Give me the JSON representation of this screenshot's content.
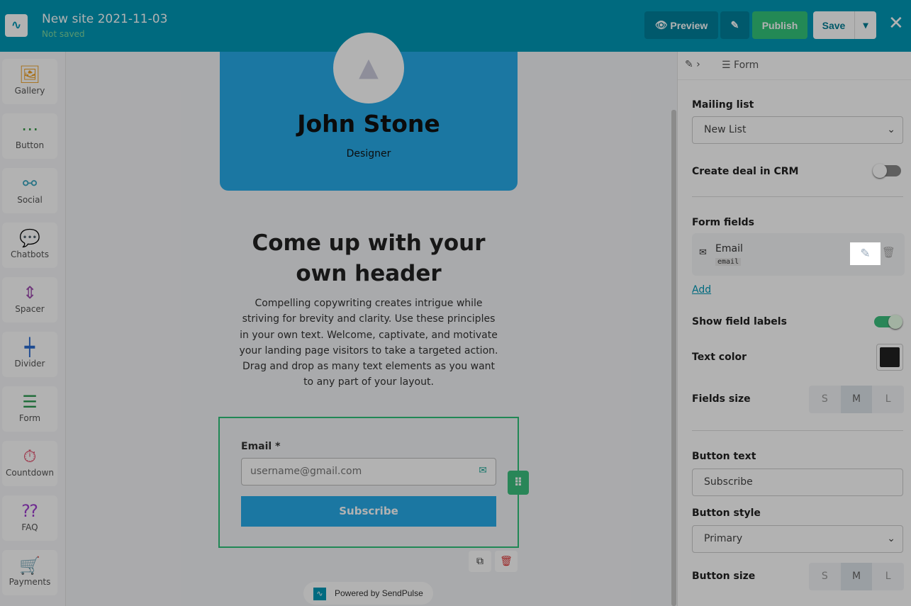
{
  "header": {
    "title": "New site 2021-11-03",
    "status": "Not saved",
    "preview": "Preview",
    "publish": "Publish",
    "save": "Save"
  },
  "sidebar": [
    {
      "label": "Gallery",
      "icon": "🖼",
      "color": "#f0a020"
    },
    {
      "label": "Button",
      "icon": "⋯",
      "color": "#3a9a4a"
    },
    {
      "label": "Social",
      "icon": "⚯",
      "color": "#3aa6c0"
    },
    {
      "label": "Chatbots",
      "icon": "💬",
      "color": "#2a6bd0"
    },
    {
      "label": "Spacer",
      "icon": "⇕",
      "color": "#a050b0"
    },
    {
      "label": "Divider",
      "icon": "┿",
      "color": "#2a6bd0"
    },
    {
      "label": "Form",
      "icon": "☰",
      "color": "#2a9a50"
    },
    {
      "label": "Countdown",
      "icon": "⏱",
      "color": "#e04060"
    },
    {
      "label": "FAQ",
      "icon": "⁇",
      "color": "#a040d0"
    },
    {
      "label": "Payments",
      "icon": "🛒",
      "color": "#e0a010"
    }
  ],
  "canvas": {
    "name": "John Stone",
    "role": "Designer",
    "heading": "Come up with your own header",
    "paragraph": "Compelling copywriting creates intrigue while striving for brevity and clarity. Use these principles in your own text. Welcome, captivate, and motivate your landing page visitors to take a targeted action. Drag and drop as many text elements as you want to any part of your layout.",
    "form_label": "Email *",
    "form_placeholder": "username@gmail.com",
    "form_button": "Subscribe",
    "powered": "Powered by SendPulse"
  },
  "panel": {
    "breadcrumb": "Form",
    "mailing_list_label": "Mailing list",
    "mailing_list": "New List",
    "crm_label": "Create deal in CRM",
    "crm_on": false,
    "form_fields_label": "Form fields",
    "field_name": "Email",
    "field_tag": "email",
    "add": "Add",
    "show_labels": "Show field labels",
    "show_labels_on": true,
    "text_color_label": "Text color",
    "text_color": "#222222",
    "fields_size_label": "Fields size",
    "sizes": [
      "S",
      "M",
      "L"
    ],
    "fields_size": "M",
    "button_text_label": "Button text",
    "button_text": "Subscribe",
    "button_style_label": "Button style",
    "button_style": "Primary",
    "button_size_label": "Button size",
    "button_size": "M"
  }
}
